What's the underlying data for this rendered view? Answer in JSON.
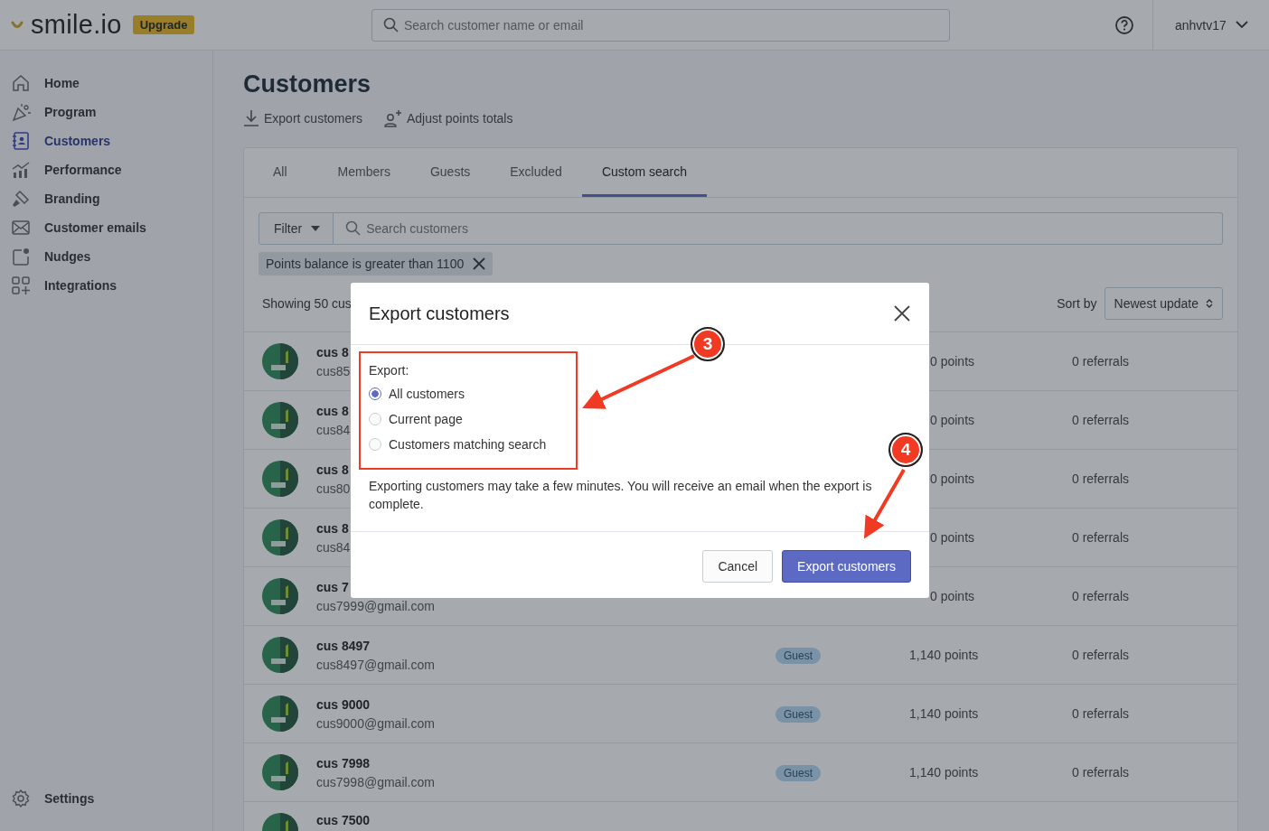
{
  "header": {
    "logo": "smile.io",
    "upgrade_badge": "Upgrade",
    "search": {
      "placeholder": "Search customer name or email"
    },
    "user": "anhvtv17"
  },
  "sidebar": {
    "items": [
      {
        "label": "Home",
        "selected": false
      },
      {
        "label": "Program",
        "selected": false
      },
      {
        "label": "Customers",
        "selected": true
      },
      {
        "label": "Performance",
        "selected": false
      },
      {
        "label": "Branding",
        "selected": false
      },
      {
        "label": "Customer emails",
        "selected": false
      },
      {
        "label": "Nudges",
        "selected": false
      },
      {
        "label": "Integrations",
        "selected": false
      }
    ],
    "settings": "Settings"
  },
  "page": {
    "title": "Customers",
    "actions": [
      {
        "label": "Export customers"
      },
      {
        "label": "Adjust points totals"
      }
    ]
  },
  "tabs": [
    {
      "label": "All",
      "selected": false
    },
    {
      "label": "Members",
      "selected": false
    },
    {
      "label": "Guests",
      "selected": false
    },
    {
      "label": "Excluded",
      "selected": false
    },
    {
      "label": "Custom search",
      "selected": true
    }
  ],
  "filter": {
    "button": "Filter",
    "placeholder": "Search customers",
    "chip": "Points balance is greater than 1100"
  },
  "showing": "Showing 50 cus",
  "sort": {
    "label": "Sort by",
    "value": "Newest update"
  },
  "rows": [
    {
      "kind": "covered",
      "name": "cus 8",
      "email": "cus85",
      "points": "0 points",
      "referrals": "0 referrals"
    },
    {
      "kind": "covered",
      "name": "cus 8",
      "email": "cus84",
      "points": "0 points",
      "referrals": "0 referrals"
    },
    {
      "kind": "covered",
      "name": "cus 8",
      "email": "cus80",
      "points": "0 points",
      "referrals": "0 referrals"
    },
    {
      "kind": "covered",
      "name": "cus 8",
      "email": "cus84",
      "points": "0 points",
      "referrals": "0 referrals"
    },
    {
      "kind": "covered",
      "name": "cus 7",
      "email": "cus7999@gmail.com",
      "points": "0 points",
      "referrals": "0 referrals"
    },
    {
      "kind": "full",
      "name": "cus 8497",
      "email": "cus8497@gmail.com",
      "badge": "Guest",
      "points": "1,140 points",
      "referrals": "0 referrals"
    },
    {
      "kind": "full",
      "name": "cus 9000",
      "email": "cus9000@gmail.com",
      "badge": "Guest",
      "points": "1,140 points",
      "referrals": "0 referrals"
    },
    {
      "kind": "full",
      "name": "cus 7998",
      "email": "cus7998@gmail.com",
      "badge": "Guest",
      "points": "1,140 points",
      "referrals": "0 referrals"
    },
    {
      "kind": "cut",
      "name": "cus 7500"
    }
  ],
  "modal": {
    "title": "Export customers",
    "group_label": "Export:",
    "options": [
      {
        "label": "All customers",
        "selected": true
      },
      {
        "label": "Current page",
        "selected": false
      },
      {
        "label": "Customers matching search",
        "selected": false
      }
    ],
    "note": "Exporting customers may take a few minutes. You will receive an email when the export is complete.",
    "buttons": [
      {
        "label": "Cancel",
        "kind": "secondary"
      },
      {
        "label": "Export customers",
        "kind": "primary"
      }
    ]
  },
  "callouts": [
    "3",
    "4"
  ]
}
